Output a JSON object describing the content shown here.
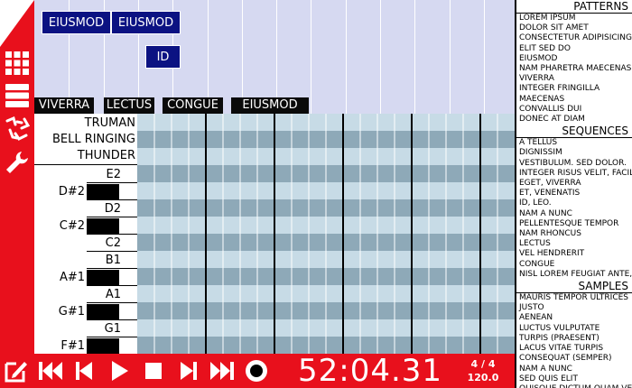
{
  "colors": {
    "accent": "#e8101c",
    "timeline_bg": "#d6d9f1",
    "block": "#0b1282",
    "grid_light": "#c7dbe6",
    "grid_dark": "#8ea9b8"
  },
  "sidebar": {
    "icons": [
      "grid-icon",
      "list-icon",
      "recycle-icon",
      "wrench-icon"
    ]
  },
  "timeline": {
    "blocks": [
      "EIUSMOD",
      "EIUSMOD",
      "ID"
    ],
    "markers": [
      "VIVERRA",
      "LECTUS",
      "CONGUE",
      "EIUSMOD"
    ]
  },
  "tracks": [
    "TRUMAN",
    "BELL RINGING",
    "THUNDER"
  ],
  "keys": [
    "E2",
    "D#2",
    "D2",
    "C#2",
    "C2",
    "B1",
    "A#1",
    "A1",
    "G#1",
    "G1",
    "F#1"
  ],
  "transport": {
    "icons": [
      "edit-icon",
      "rewind-icon",
      "previous-icon",
      "play-icon",
      "stop-icon",
      "next-icon",
      "fast-forward-icon",
      "record-icon"
    ],
    "time": "52:04.31",
    "signature": "4 / 4",
    "tempo": "120.0"
  },
  "browser": {
    "patterns_title": "PATTERNS",
    "patterns": [
      "LOREM IPSUM",
      "DOLOR SIT AMET",
      "CONSECTETUR ADIPISICING",
      "ELIT SED DO",
      "EIUSMOD",
      "NAM PHARETRA MAECENAS",
      "VIVERRA",
      "INTEGER FRINGILLA",
      "MAECENAS",
      "CONVALLIS DUI",
      "DONEC AT DIAM"
    ],
    "sequences_title": "SEQUENCES",
    "sequences": [
      "A TELLUS",
      "DIGNISSIM",
      "VESTIBULUM. SED DOLOR.",
      "INTEGER RISUS VELIT, FACILISIS",
      "EGET, VIVERRA",
      "ET, VENENATIS",
      "ID, LEO.",
      "NAM A NUNC",
      "PELLENTESQUE TEMPOR",
      "NAM RHONCUS",
      "LECTUS",
      "VEL HENDRERIT",
      "CONGUE",
      "NISL LOREM FEUGIAT ANTE, AT"
    ],
    "samples_title": "SAMPLES",
    "samples": [
      "MAURIS TEMPOR ULTRICES",
      "JUSTO",
      "AENEAN",
      "LUCTUS VULPUTATE",
      "TURPIS (PRAESENT)",
      "LACUS VITAE TURPIS",
      "CONSEQUAT (SEMPER)",
      "NAM A NUNC",
      "SED QUIS ELIT",
      "QUISQUE DICTUM QUAM VEL"
    ]
  }
}
